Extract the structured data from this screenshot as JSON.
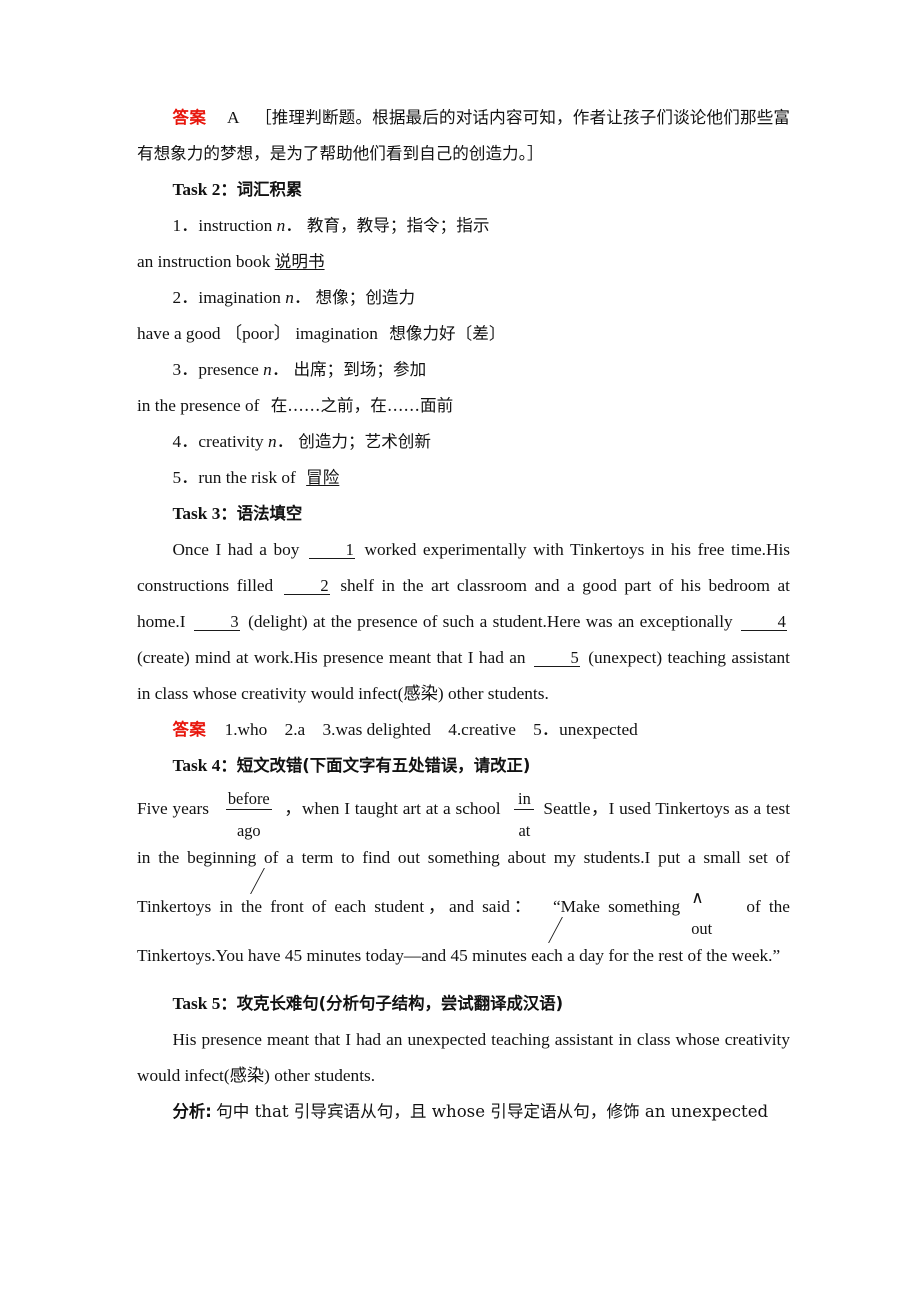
{
  "answer_label": "答案",
  "q1_answer": {
    "choice": "A",
    "explanation": "［推理判断题。根据最后的对话内容可知，作者让孩子们谈论他们那些富有想象力的梦想，是为了帮助他们看到自己的创造力。］"
  },
  "task2": {
    "title_en": "Task 2",
    "title_sep": "：",
    "title_cn": "词汇积累",
    "items": [
      {
        "num": "1．",
        "word": "instruction",
        "pos": "n",
        "pos_dot": "．",
        "meaning": "教育，教导；指令；指示",
        "phrase": "an instruction book",
        "phrase_meaning": "说明书"
      },
      {
        "num": "2．",
        "word": "imagination",
        "pos": "n",
        "pos_dot": "．",
        "meaning": "想像；创造力",
        "phrase": "have a good 〔poor〕 imagination",
        "phrase_meaning": "想像力好〔差〕"
      },
      {
        "num": "3．",
        "word": "presence",
        "pos": "n",
        "pos_dot": "．",
        "meaning": "出席；到场；参加",
        "phrase": "in the presence of",
        "phrase_meaning": "在……之前，在……面前"
      },
      {
        "num": "4．",
        "word": "creativity",
        "pos": "n",
        "pos_dot": "．",
        "meaning": "创造力；艺术创新",
        "phrase": "",
        "phrase_meaning": ""
      },
      {
        "num": "5．",
        "word": "run the risk of",
        "pos": "",
        "pos_dot": "",
        "meaning": "",
        "phrase": "",
        "phrase_meaning": "冒险"
      }
    ]
  },
  "task3": {
    "title_en": "Task 3",
    "title_sep": "：",
    "title_cn": "语法填空",
    "text_a": "Once I had a boy",
    "blank1": "1",
    "text_b": "worked experimentally with Tinkertoys in his free time.His constructions filled",
    "blank2": "2",
    "text_c": "shelf in the art classroom and a good part of his bedroom at home.I",
    "blank3": "3",
    "text_d": "(delight) at the presence of such a student.Here was an exceptionally",
    "blank4": "4",
    "text_e": "(create) mind at work.His presence meant that I had an",
    "blank5": "5",
    "text_f": "(unexpect) teaching assistant in class whose creativity would infect(感染) other students.",
    "answers": "1.who　2.a　3.was delighted　4.creative　5．unexpected"
  },
  "task4": {
    "title_en": "Task 4",
    "title_sep": "：",
    "title_cn": "短文改错(下面文字有五处错误，请改正)",
    "seg1": "Five years",
    "corr1_top": "before",
    "corr1_bottom": "ago",
    "seg2": "，when I taught art at a school",
    "corr2_top": "in",
    "corr2_bottom": "at",
    "seg3": "Seattle，I used Tinkertoys as a test in the beginning of a term to find out something about my students.I put a small set of Tinkertoys in",
    "del1": "th",
    "del1_rest": "e",
    "seg4": "front of each student，and said：",
    "quote_open": "“",
    "seg5": "Make something",
    "ins_caret": "∧",
    "ins_word": "out",
    "seg6": "of the Tinkertoys.You have 45 minutes today—and 45 minutes e",
    "del2": "a",
    "del2_rest": "ch",
    "seg7": "a day for the rest of the week.",
    "quote_close": "”"
  },
  "task5": {
    "title_en": "Task 5",
    "title_sep": "：",
    "title_cn": "攻克长难句(分析句子结构，尝试翻译成汉语)",
    "sentence": "His presence meant that I had an unexpected teaching assistant in class whose creativity would infect(感染) other students.",
    "analysis_label": "分析:",
    "analysis_text": "句中 that 引导宾语从句，且 whose 引导定语从句，修饰 an unexpected"
  }
}
